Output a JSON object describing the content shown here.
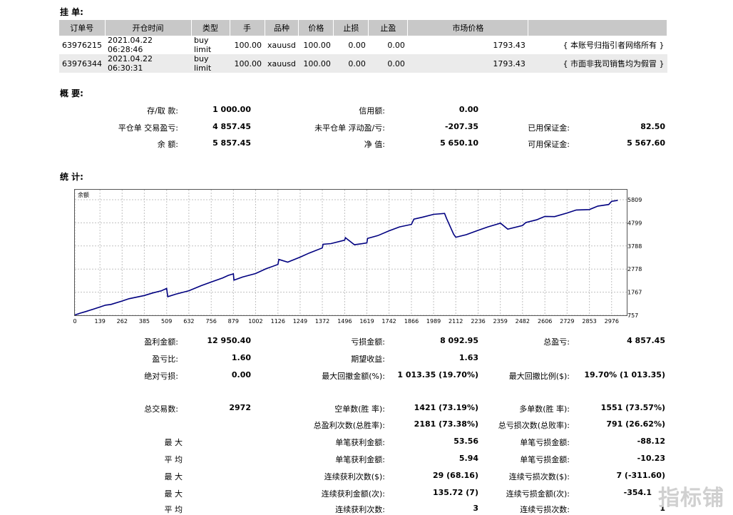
{
  "orders": {
    "title": "挂 单:",
    "headers": [
      "订单号",
      "开仓时间",
      "类型",
      "手",
      "品种",
      "价格",
      "止损",
      "止盈",
      "市场价格",
      ""
    ],
    "rows": [
      [
        "63976215",
        "2021.04.22 06:28:46",
        "buy limit",
        "100.00",
        "xauusd",
        "100.00",
        "0.00",
        "0.00",
        "1793.43",
        "{ 本账号归指引者网络所有 }"
      ],
      [
        "63976344",
        "2021.04.22 06:30:31",
        "buy limit",
        "100.00",
        "xauusd",
        "100.00",
        "0.00",
        "0.00",
        "1793.43",
        "{ 市面非我司销售均为假冒 }"
      ]
    ]
  },
  "summary": {
    "title": "概 要:",
    "deposit_label": "存/取 款:",
    "deposit_value": "1 000.00",
    "credit_label": "信用额:",
    "credit_value": "0.00",
    "closed_pl_label": "平仓单 交易盈亏:",
    "closed_pl_value": "4 857.45",
    "floating_pl_label": "未平仓单 浮动盈/亏:",
    "floating_pl_value": "-207.35",
    "margin_label": "已用保证金:",
    "margin_value": "82.50",
    "balance_label": "余 额:",
    "balance_value": "5 857.45",
    "equity_label": "净 值:",
    "equity_value": "5 650.10",
    "free_margin_label": "可用保证金:",
    "free_margin_value": "5 567.60"
  },
  "stats_title": "统 计:",
  "chart_data": {
    "type": "line",
    "title": "余额",
    "x_ticks": [
      0,
      139,
      262,
      385,
      509,
      632,
      756,
      879,
      1002,
      1126,
      1249,
      1372,
      1496,
      1619,
      1742,
      1866,
      1989,
      2112,
      2236,
      2359,
      2482,
      2606,
      2729,
      2853,
      2976
    ],
    "y_ticks": [
      757,
      1767,
      2778,
      3788,
      4799,
      5809
    ],
    "xlim": [
      0,
      3060
    ],
    "ylim": [
      757,
      5809
    ],
    "series": [
      {
        "x": [
          0,
          30,
          60,
          100,
          139,
          170,
          200,
          262,
          300,
          385,
          430,
          480,
          509,
          515,
          560,
          632,
          700,
          756,
          820,
          850,
          879,
          882,
          930,
          1002,
          1060,
          1126,
          1131,
          1180,
          1249,
          1300,
          1372,
          1376,
          1420,
          1496,
          1500,
          1550,
          1619,
          1623,
          1680,
          1742,
          1800,
          1866,
          1880,
          1930,
          1989,
          2050,
          2061,
          2100,
          2112,
          2170,
          2236,
          2290,
          2350,
          2359,
          2400,
          2482,
          2500,
          2560,
          2606,
          2660,
          2729,
          2780,
          2853,
          2900,
          2960,
          2976,
          3010
        ],
        "y": [
          770,
          850,
          920,
          1020,
          1120,
          1200,
          1230,
          1380,
          1480,
          1620,
          1730,
          1830,
          1930,
          1570,
          1680,
          1830,
          2050,
          2210,
          2390,
          2500,
          2570,
          2290,
          2430,
          2580,
          2790,
          2980,
          3200,
          3080,
          3300,
          3480,
          3700,
          3860,
          3890,
          4040,
          4150,
          3840,
          3920,
          4120,
          4240,
          4450,
          4620,
          4730,
          4960,
          5050,
          5170,
          5210,
          4990,
          4300,
          4170,
          4280,
          4470,
          4620,
          4760,
          4790,
          4520,
          4680,
          4810,
          4930,
          5080,
          5070,
          5230,
          5360,
          5380,
          5530,
          5600,
          5740,
          5780
        ]
      }
    ]
  },
  "stats": {
    "gross_profit_label": "盈利金额:",
    "gross_profit_value": "12 950.40",
    "gross_loss_label": "亏损金额:",
    "gross_loss_value": "8 092.95",
    "total_pl_label": "总盈亏:",
    "total_pl_value": "4 857.45",
    "profit_factor_label": "盈亏比:",
    "profit_factor_value": "1.60",
    "expected_payoff_label": "期望收益:",
    "expected_payoff_value": "1.63",
    "abs_drawdown_label": "绝对亏损:",
    "abs_drawdown_value": "0.00",
    "max_dd_label": "最大回撤金额(%):",
    "max_dd_value": "1 013.35 (19.70%)",
    "max_dd_pct_label": "最大回撤比例($):",
    "max_dd_pct_value": "19.70% (1 013.35)",
    "total_trades_label": "总交易数:",
    "total_trades_value": "2972",
    "short_label": "空单数(胜 率):",
    "short_value": "1421 (73.19%)",
    "long_label": "多单数(胜 率):",
    "long_value": "1551 (73.57%)",
    "profit_trades_label": "总盈利次数(总胜率):",
    "profit_trades_value": "2181 (73.38%)",
    "loss_trades_label": "总亏损次数(总败率):",
    "loss_trades_value": "791 (26.62%)",
    "largest_label": "最 大",
    "largest_profit_label": "单笔获利金额:",
    "largest_profit_value": "53.56",
    "largest_loss_label": "单笔亏损金额:",
    "largest_loss_value": "-88.12",
    "average_label": "平 均",
    "avg_profit_label": "单笔获利金额:",
    "avg_profit_value": "5.94",
    "avg_loss_label": "单笔亏损金额:",
    "avg_loss_value": "-10.23",
    "max_consec_label": "最 大",
    "max_consec_wins_label": "连续获利次数($):",
    "max_consec_wins_value": "29 (68.16)",
    "max_consec_losses_label": "连续亏损次数($):",
    "max_consec_losses_value": "7 (-311.60)",
    "max_consec2_label": "最 大",
    "max_consec_profit_label": "连续获利金额(次):",
    "max_consec_profit_value": "135.72 (7)",
    "max_consec_loss_label": "连续亏损金额(次):",
    "max_consec_loss_value": "-354.1",
    "avg_consec_label": "平 均",
    "avg_consec_wins_label": "连续获利次数:",
    "avg_consec_wins_value": "3",
    "avg_consec_losses_label": "连续亏损次数:",
    "avg_consec_losses_value": "1"
  },
  "watermark": "指标铺",
  "colors": {
    "line": "#000080",
    "header_bg": "#c8c8c8",
    "alt_row": "#ebebeb",
    "grid": "#c0c0c0"
  }
}
